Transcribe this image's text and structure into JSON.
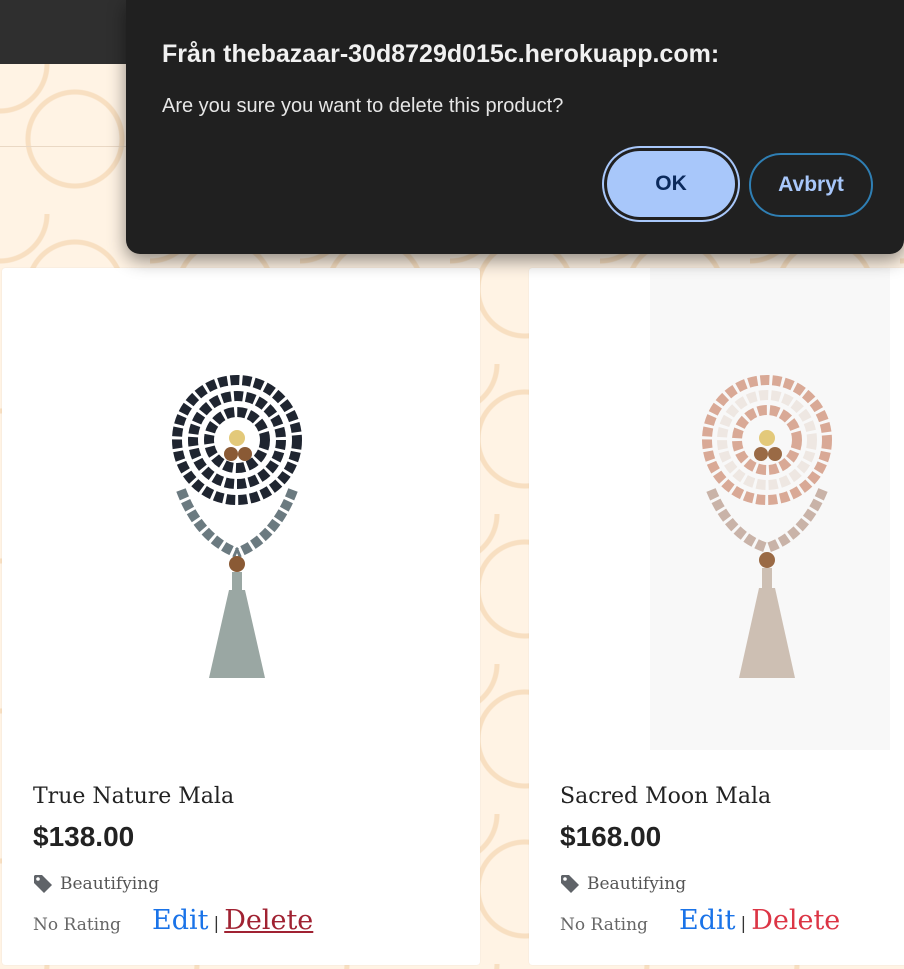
{
  "dialog": {
    "origin": "Från thebazaar-30d8729d015c.herokuapp.com:",
    "message": "Are you sure you want to delete this product?",
    "ok_label": "OK",
    "cancel_label": "Avbryt"
  },
  "products": [
    {
      "name": "True Nature Mala",
      "price": "$138.00",
      "category": "Beautifying",
      "rating": "No Rating",
      "edit_label": "Edit",
      "separator": "|",
      "delete_label": "Delete",
      "bead_color": "#1f2530",
      "tassel_color": "#9aa7a3"
    },
    {
      "name": "Sacred Moon Mala",
      "price": "$168.00",
      "category": "Beautifying",
      "rating": "No Rating",
      "edit_label": "Edit",
      "separator": "|",
      "delete_label": "Delete",
      "bead_color": "#d9a996",
      "tassel_color": "#cdbfb3"
    }
  ],
  "colors": {
    "edit": "#1a73e8",
    "delete": "#dc3545",
    "dialog_bg": "#202020",
    "ok_bg": "#a8c7fa"
  }
}
